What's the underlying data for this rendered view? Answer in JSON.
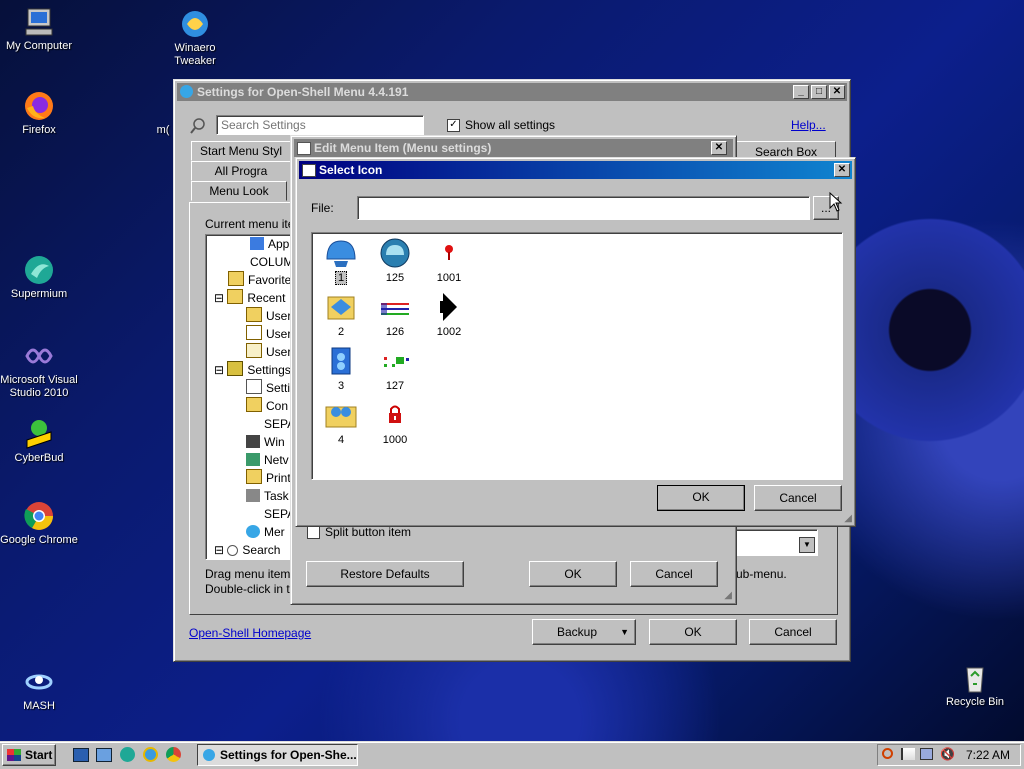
{
  "desktop": {
    "icons": [
      {
        "label": "My Computer",
        "icon": "computer-icon"
      },
      {
        "label": "Winaero Tweaker",
        "icon": "winaero-icon"
      },
      {
        "label": "Firefox",
        "icon": "firefox-icon"
      },
      {
        "label": "Supermium",
        "icon": "supermium-icon"
      },
      {
        "label": "Microsoft Visual Studio 2010",
        "icon": "visual-studio-icon"
      },
      {
        "label": "CyberBud",
        "icon": "cyberbud-icon"
      },
      {
        "label": "Google Chrome",
        "icon": "chrome-icon"
      },
      {
        "label": "MASH",
        "icon": "mash-icon"
      },
      {
        "label": "Recycle Bin",
        "icon": "recycle-bin-icon"
      },
      {
        "label": "m("
      }
    ]
  },
  "settings_window": {
    "title": "Settings for Open-Shell Menu 4.4.191",
    "search_placeholder": "Search Settings",
    "show_all_label": "Show all settings",
    "help_link": "Help...",
    "tabs": [
      "Start Menu Styl",
      "All Progra",
      "Menu Look",
      "Search Box"
    ],
    "current_menu_label": "Current menu ite",
    "tree": [
      "App",
      "COLUM",
      "Favorite",
      "Recent",
      "User",
      "User",
      "User",
      "Settings",
      "Setti",
      "Con",
      "SEPA",
      "Win",
      "Netv",
      "Print",
      "Task",
      "SEPA",
      "Mer",
      "Search"
    ],
    "hint_line1": "Drag menu item",
    "hint_line2": "Double-click in t",
    "submenu_hint": "ub-menu.",
    "homepage_link": "Open-Shell Homepage",
    "backup_label": "Backup",
    "ok_label": "OK",
    "cancel_label": "Cancel"
  },
  "edit_window": {
    "title": "Edit Menu Item (Menu settings)",
    "split_button_label": "Split button item",
    "restore_label": "Restore Defaults",
    "ok_label": "OK",
    "cancel_label": "Cancel"
  },
  "select_icon": {
    "title": "Select Icon",
    "file_label": "File:",
    "file_value": "",
    "browse_label": "...",
    "icons": [
      {
        "label": "1",
        "icon": "shell-icon"
      },
      {
        "label": "2",
        "icon": "folder-start-icon"
      },
      {
        "label": "3",
        "icon": "blue-book-icon"
      },
      {
        "label": "4",
        "icon": "users-folder-icon"
      },
      {
        "label": "125",
        "icon": "shell-orb-icon"
      },
      {
        "label": "126",
        "icon": "color-grid-icon"
      },
      {
        "label": "127",
        "icon": "dot-grid-icon"
      },
      {
        "label": "1000",
        "icon": "lock-icon"
      },
      {
        "label": "1001",
        "icon": "pin-icon"
      },
      {
        "label": "1002",
        "icon": "arrow-right-icon"
      }
    ],
    "ok_label": "OK",
    "cancel_label": "Cancel"
  },
  "taskbar": {
    "start_label": "Start",
    "task_label": "Settings for Open-She...",
    "clock": "7:22 AM"
  }
}
